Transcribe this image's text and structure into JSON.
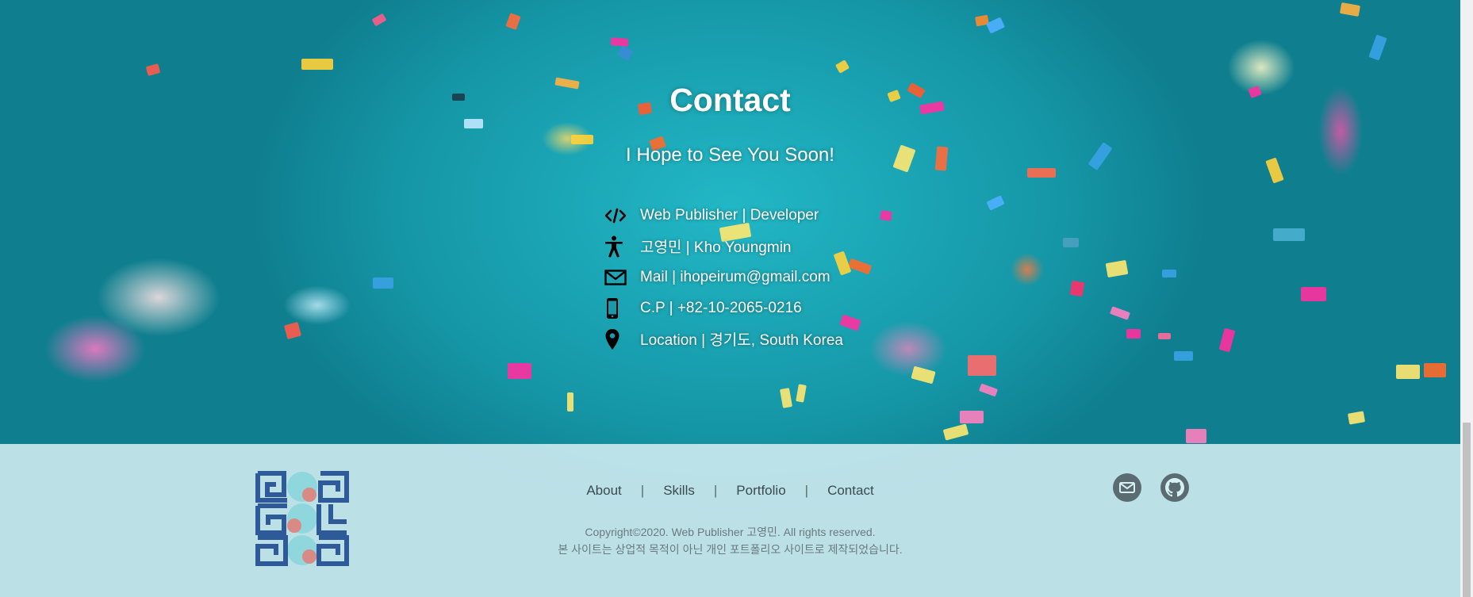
{
  "contact": {
    "title": "Contact",
    "subtitle": "I Hope to See You Soon!",
    "items": [
      {
        "icon": "code-icon",
        "text": "Web Publisher | Developer"
      },
      {
        "icon": "person-icon",
        "text": "고영민 | Kho Youngmin"
      },
      {
        "icon": "mail-icon",
        "text": "Mail | ihopeirum@gmail.com"
      },
      {
        "icon": "phone-icon",
        "text": "C.P | +82-10-2065-0216"
      },
      {
        "icon": "location-pin-icon",
        "text": "Location | 경기도, South Korea"
      }
    ]
  },
  "footer": {
    "nav": {
      "about": "About",
      "skills": "Skills",
      "portfolio": "Portfolio",
      "contact": "Contact",
      "separator": "|"
    },
    "copyright": "Copyright©2020. Web Publisher 고영민. All rights reserved.",
    "disclaimer": "본 사이트는 상업적 목적이 아닌 개인 포트폴리오 사이트로 제작되었습니다.",
    "social": [
      "mail-icon",
      "github-icon"
    ]
  },
  "colors": {
    "background": "#1a9aa8",
    "footer_bg": "#d7f0f4",
    "logo_blue": "#2f5a9a",
    "logo_teal": "#8fd7dc",
    "logo_pink": "#d98a84"
  }
}
